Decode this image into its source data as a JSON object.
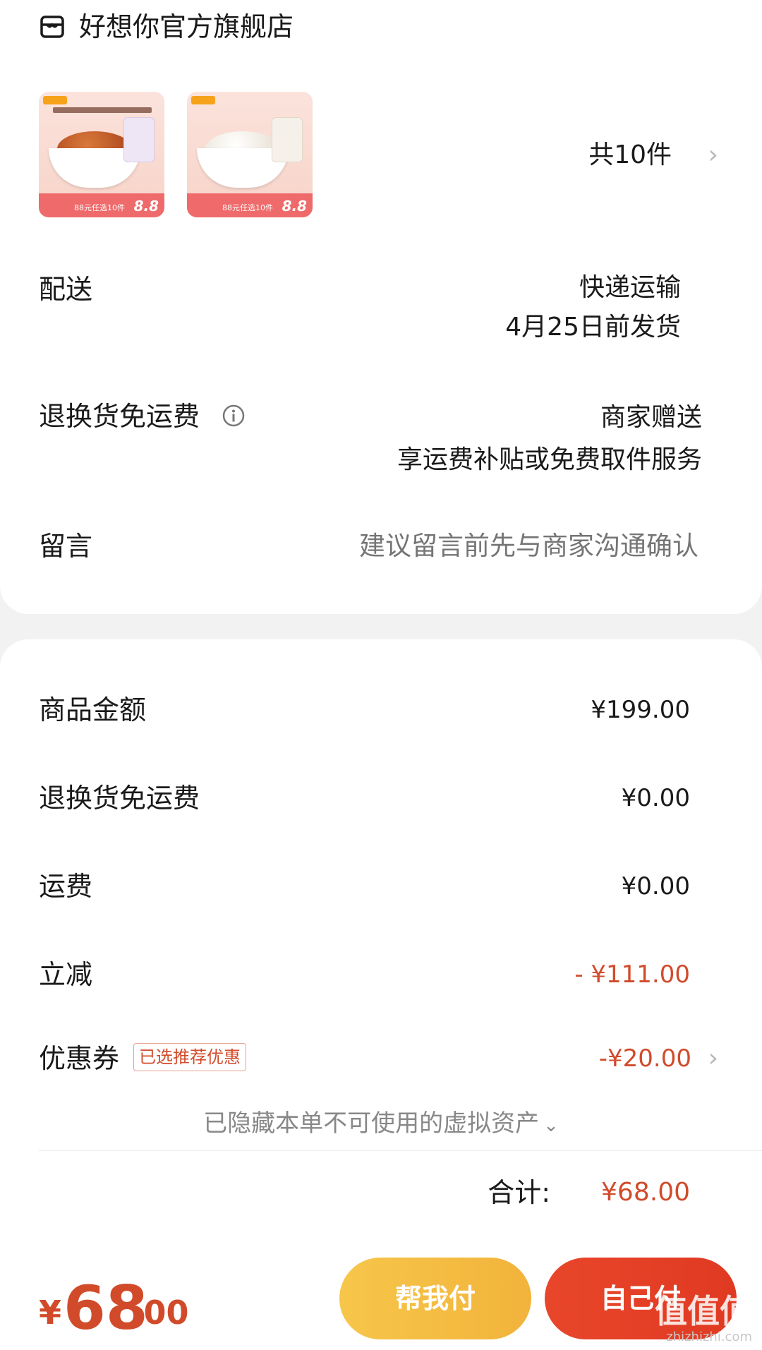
{
  "store": {
    "name": "好想你官方旗舰店",
    "icon": "store-icon"
  },
  "products": {
    "thumbnails": [
      {
        "promo_text": "88元任选10件",
        "promo_price": "8.8"
      },
      {
        "promo_text": "88元任选10件",
        "promo_price": "8.8"
      }
    ],
    "count": "共10件"
  },
  "shipping": {
    "label": "配送",
    "method": "快递运输",
    "date": "4月25日前发货"
  },
  "return_shipping": {
    "label": "退换货免运费",
    "value1": "商家赠送",
    "value2": "享运费补贴或免费取件服务"
  },
  "message": {
    "label": "留言",
    "placeholder": "建议留言前先与商家沟通确认"
  },
  "costs": {
    "goods_amount": {
      "label": "商品金额",
      "value": "¥199.00"
    },
    "return_shipping_fee": {
      "label": "退换货免运费",
      "value": "¥0.00"
    },
    "shipping_fee": {
      "label": "运费",
      "value": "¥0.00"
    },
    "instant_discount": {
      "label": "立减",
      "value": "- ¥111.00"
    },
    "coupon": {
      "label": "优惠券",
      "badge": "已选推荐优惠",
      "value": "-¥20.00"
    }
  },
  "hidden_assets": {
    "text": "已隐藏本单不可使用的虚拟资产",
    "caret": "⌄"
  },
  "total": {
    "label": "合计:",
    "value": "¥68.00"
  },
  "bottom": {
    "currency": "¥",
    "price_int": "68",
    "price_dec": ".00",
    "help_pay": "帮我付",
    "self_pay": "自己付",
    "watermark": "值值值",
    "watermark_sub": "zhizhizhi.com"
  },
  "colors": {
    "accent_red": "#d14b2b",
    "help_button": "#f2b33b",
    "self_button": "#e03a22",
    "placeholder_gray": "#bdbdbd"
  }
}
